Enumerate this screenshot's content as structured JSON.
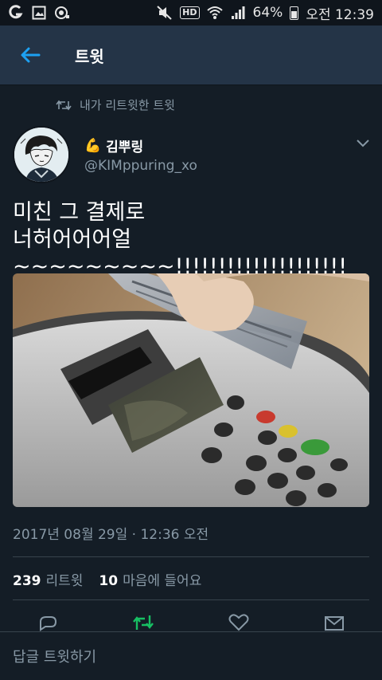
{
  "status_bar": {
    "battery": "64%",
    "time": "오전 12:39",
    "hd_label": "HD",
    "left_icons": [
      "carrier-g-icon",
      "gallery-icon",
      "camera-record-icon"
    ],
    "right_icons": [
      "mute-icon",
      "hd-voice-icon",
      "wifi-icon",
      "signal-icon",
      "battery-icon"
    ]
  },
  "header": {
    "title": "트윗",
    "back_icon": "arrow-left-icon"
  },
  "retweet_context": {
    "text": "내가 리트윗한 트윗",
    "icon": "retweet-icon"
  },
  "author": {
    "emoji": "💪",
    "name": "김뿌링",
    "handle": "@KIMppuring_xo"
  },
  "tweet": {
    "text": "미친 그 결제로\n너허어어어얼~~~~~~~~~!!!!!!!!!!!!!!!!!!!!"
  },
  "timestamp": "2017년 08월 29일 · 12:36 오전",
  "stats": {
    "retweets_count": "239",
    "retweets_label": "리트윗",
    "likes_count": "10",
    "likes_label": "마음에 들어요"
  },
  "actions": [
    "reply-icon",
    "retweet-icon",
    "like-icon",
    "share-icon"
  ],
  "reply": {
    "placeholder": "답글 트윗하기"
  },
  "colors": {
    "background": "#141d26",
    "appbar": "#243447",
    "accent": "#1da1f2",
    "muted": "#8899a6",
    "retweet_active": "#17bf63"
  }
}
